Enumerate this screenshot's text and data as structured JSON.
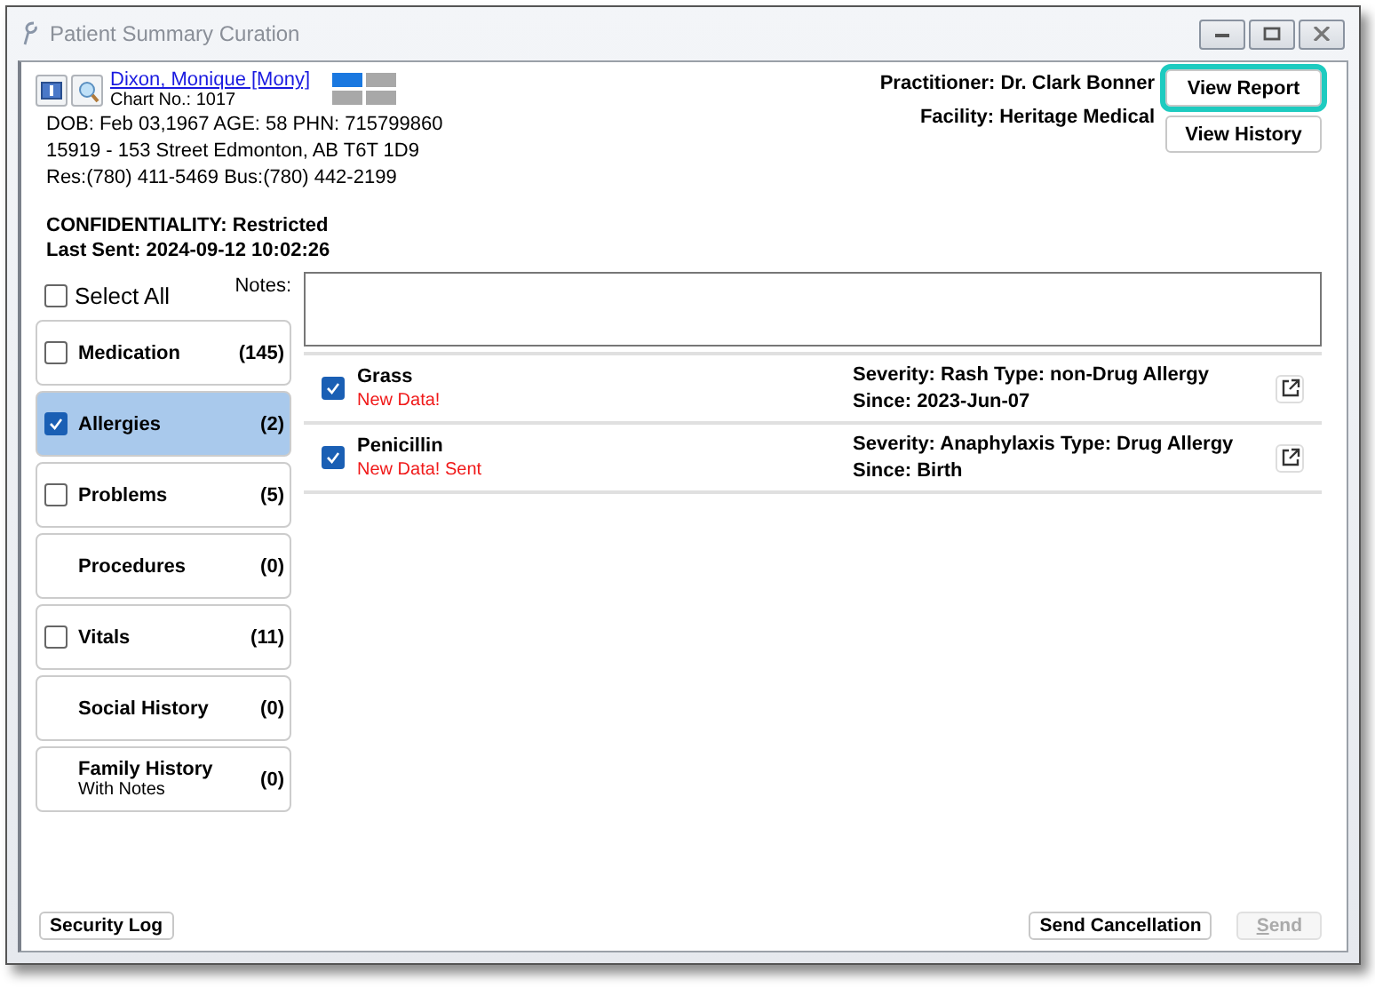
{
  "window": {
    "title": "Patient Summary Curation"
  },
  "patient": {
    "name": "Dixon, Monique [Mony]",
    "chart_no": "Chart No.: 1017",
    "lines": [
      "DOB: Feb 03,1967  AGE: 58   PHN: 715799860",
      "15919 - 153 Street Edmonton, AB  T6T 1D9",
      "Res:(780) 411-5469 Bus:(780) 442-2199"
    ],
    "confidentiality": "CONFIDENTIALITY: Restricted",
    "last_sent": "Last Sent: 2024-09-12 10:02:26"
  },
  "practitioner": "Practitioner: Dr. Clark Bonner",
  "facility": "Facility: Heritage Medical",
  "header_buttons": [
    {
      "label": "View Report",
      "highlighted": true
    },
    {
      "label": "View History",
      "highlighted": false
    }
  ],
  "select_all": {
    "label": "Select All",
    "checked": false
  },
  "notes": {
    "label": "Notes:"
  },
  "categories": [
    {
      "kind": "checkbox",
      "label": "Medication",
      "count": "(145)",
      "checked": false,
      "selected": false
    },
    {
      "kind": "checkbox",
      "label": "Allergies",
      "count": "(2)",
      "checked": true,
      "selected": true
    },
    {
      "kind": "checkbox",
      "label": "Problems",
      "count": "(5)",
      "checked": false,
      "selected": false
    },
    {
      "kind": "plain",
      "label": "Procedures",
      "count": "(0)",
      "selected": false
    },
    {
      "kind": "checkbox",
      "label": "Vitals",
      "count": "(11)",
      "checked": false,
      "selected": false
    },
    {
      "kind": "plain",
      "label": "Social History",
      "count": "(0)",
      "selected": false
    },
    {
      "kind": "plain",
      "label": "Family History",
      "count": "(0)",
      "sublabel": "With Notes",
      "selected": false
    }
  ],
  "allergies": [
    {
      "name": "Grass",
      "status": "New Data!",
      "checked": true,
      "detail": "Severity: Rash Type: non-Drug Allergy",
      "since": "Since: 2023-Jun-07"
    },
    {
      "name": "Penicillin",
      "status": "New Data! Sent",
      "checked": true,
      "detail": "Severity: Anaphylaxis Type: Drug Allergy",
      "since": "Since: Birth"
    }
  ],
  "footer": {
    "left": {
      "label": "Security Log"
    },
    "right": [
      {
        "label": "Send Cancellation",
        "disabled": false
      },
      {
        "label": "Send",
        "disabled": true
      }
    ]
  }
}
